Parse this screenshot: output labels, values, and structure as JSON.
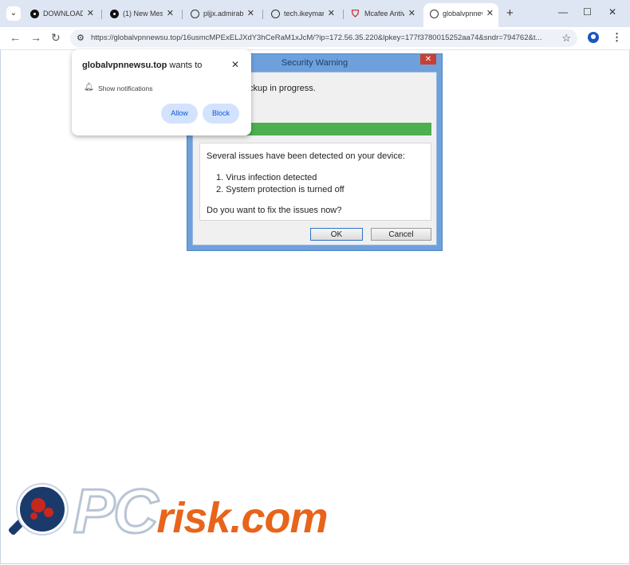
{
  "browser": {
    "tabs": [
      {
        "title": "DOWNLOAD:",
        "icon": "circle-play-icon"
      },
      {
        "title": "(1) New Mes",
        "icon": "circle-play-icon"
      },
      {
        "title": "pljjx.admirab",
        "icon": "globe-icon"
      },
      {
        "title": "tech.ikeymar",
        "icon": "globe-icon"
      },
      {
        "title": "Mcafee Antiv",
        "icon": "mcafee-shield-icon"
      },
      {
        "title": "globalvpnnev",
        "icon": "globe-icon",
        "active": true
      }
    ],
    "url": "https://globalvpnnewsu.top/16usmcMPExELJXdY3hCeRaM1xJcM/?ip=172.56.35.220&lpkey=177f3780015252aa74&sndr=794762&t..."
  },
  "notification": {
    "site": "globalvpnnewsu.top",
    "wants_to": "wants to",
    "permission": "Show notifications",
    "allow_label": "Allow",
    "block_label": "Block"
  },
  "dialog": {
    "title": "Security Warning",
    "progress_text": "ckup in progress.",
    "progress_fraction": 1.0,
    "progress_color": "#4caf50",
    "intro": "Several issues have been detected on your device:",
    "issues": [
      "1. Virus infection detected",
      "2. System protection is turned off"
    ],
    "question": "Do you want to fix the issues now?",
    "ok_label": "OK",
    "cancel_label": "Cancel"
  },
  "watermark": {
    "brand_pc": "PC",
    "brand_risk": "risk.com"
  }
}
